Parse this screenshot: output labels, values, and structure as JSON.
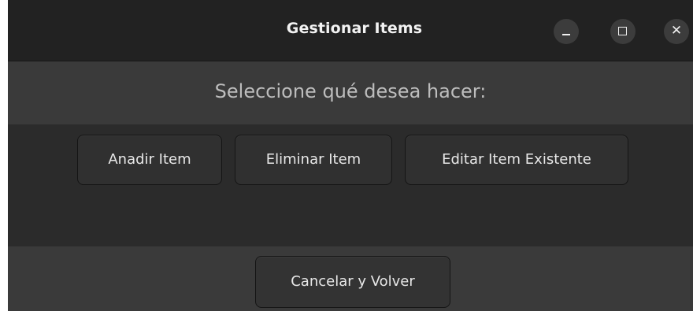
{
  "window": {
    "title": "Gestionar Items",
    "controls": {
      "minimize": "–",
      "maximize": "□",
      "close": "✕"
    }
  },
  "prompt": "Seleccione qué desea hacer:",
  "actions": {
    "add_label": "Anadir Item",
    "delete_label": "Eliminar Item",
    "edit_label": "Editar Item Existente"
  },
  "footer": {
    "cancel_label": "Cancelar y Volver"
  }
}
